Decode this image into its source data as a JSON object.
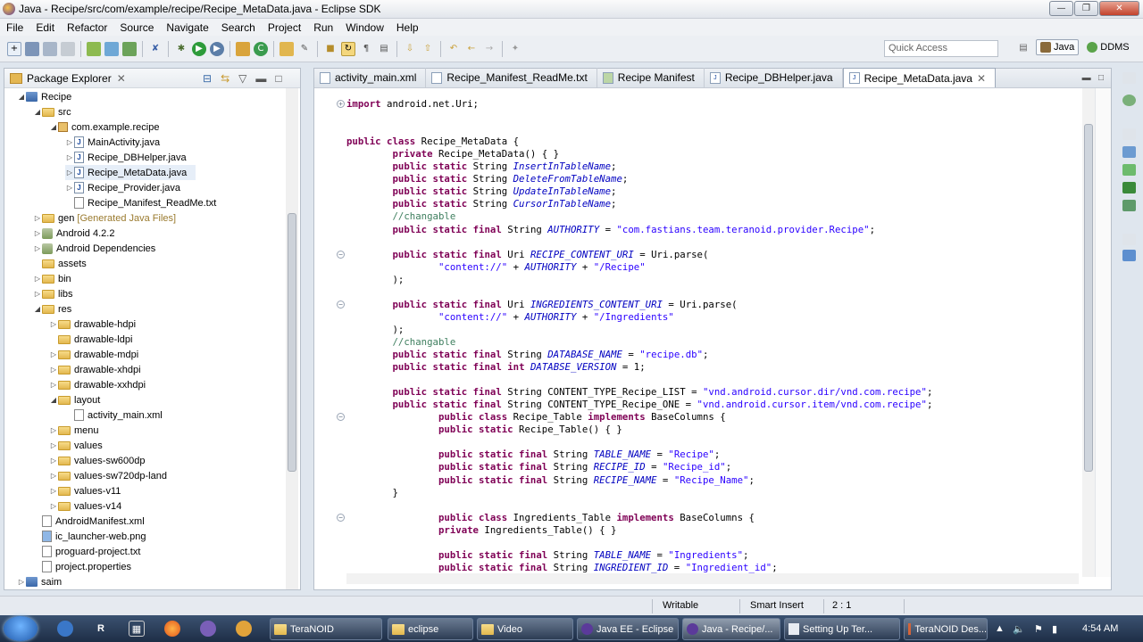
{
  "window": {
    "title": "Java - Recipe/src/com/example/recipe/Recipe_MetaData.java - Eclipse SDK"
  },
  "menu": [
    "File",
    "Edit",
    "Refactor",
    "Source",
    "Navigate",
    "Search",
    "Project",
    "Run",
    "Window",
    "Help"
  ],
  "toolbar": {
    "quick_access_placeholder": "Quick Access",
    "perspective_java": "Java",
    "perspective_ddms": "DDMS"
  },
  "package_explorer": {
    "title": "Package Explorer",
    "items": [
      {
        "label": "Recipe"
      },
      {
        "label": "src"
      },
      {
        "label": "com.example.recipe"
      },
      {
        "label": "MainActivity.java"
      },
      {
        "label": "Recipe_DBHelper.java"
      },
      {
        "label": "Recipe_MetaData.java"
      },
      {
        "label": "Recipe_Provider.java"
      },
      {
        "label": "Recipe_Manifest_ReadMe.txt"
      },
      {
        "label": "gen",
        "suffix": "[Generated Java Files]"
      },
      {
        "label": "Android 4.2.2"
      },
      {
        "label": "Android Dependencies"
      },
      {
        "label": "assets"
      },
      {
        "label": "bin"
      },
      {
        "label": "libs"
      },
      {
        "label": "res"
      },
      {
        "label": "drawable-hdpi"
      },
      {
        "label": "drawable-ldpi"
      },
      {
        "label": "drawable-mdpi"
      },
      {
        "label": "drawable-xhdpi"
      },
      {
        "label": "drawable-xxhdpi"
      },
      {
        "label": "layout"
      },
      {
        "label": "activity_main.xml"
      },
      {
        "label": "menu"
      },
      {
        "label": "values"
      },
      {
        "label": "values-sw600dp"
      },
      {
        "label": "values-sw720dp-land"
      },
      {
        "label": "values-v11"
      },
      {
        "label": "values-v14"
      },
      {
        "label": "AndroidManifest.xml"
      },
      {
        "label": "ic_launcher-web.png"
      },
      {
        "label": "proguard-project.txt"
      },
      {
        "label": "project.properties"
      },
      {
        "label": "saim"
      }
    ]
  },
  "editor": {
    "tabs": [
      "activity_main.xml",
      "Recipe_Manifest_ReadMe.txt",
      "Recipe Manifest",
      "Recipe_DBHelper.java",
      "Recipe_MetaData.java"
    ],
    "active_tab": "Recipe_MetaData.java",
    "code_lines": [
      "import android.net.Uri;",
      "",
      "",
      "public class Recipe_MetaData {",
      "        private Recipe_MetaData() { }",
      "        public static String InsertInTableName;",
      "        public static String DeleteFromTableName;",
      "        public static String UpdateInTableName;",
      "        public static String CursorInTableName;",
      "        //changable",
      "        public static final String AUTHORITY = \"com.fastians.team.teranoid.provider.Recipe\";",
      "",
      "        public static final Uri RECIPE_CONTENT_URI = Uri.parse(",
      "                \"content://\" + AUTHORITY + \"/Recipe\"",
      "        );",
      "",
      "        public static final Uri INGREDIENTS_CONTENT_URI = Uri.parse(",
      "                \"content://\" + AUTHORITY + \"/Ingredients\"",
      "        );",
      "        //changable",
      "        public static final String DATABASE_NAME = \"recipe.db\";",
      "        public static final int DATABSE_VERSION = 1;",
      "",
      "        public static final String CONTENT_TYPE_Recipe_LIST = \"vnd.android.cursor.dir/vnd.com.recipe\";",
      "        public static final String CONTENT_TYPE_Recipe_ONE = \"vnd.android.cursor.item/vnd.com.recipe\";",
      "                public class Recipe_Table implements BaseColumns {",
      "                public static Recipe_Table() { }",
      "",
      "                public static final String TABLE_NAME = \"Recipe\";",
      "                public static final String RECIPE_ID = \"Recipe_id\";",
      "                public static final String RECIPE_NAME = \"Recipe_Name\";",
      "        }",
      "",
      "                public class Ingredients_Table implements BaseColumns {",
      "                private Ingredients_Table() { }",
      "",
      "                public static final String TABLE_NAME = \"Ingredients\";",
      "                public static final String INGREDIENT_ID = \"Ingredient_id\";"
    ]
  },
  "status": {
    "writable": "Writable",
    "insert_mode": "Smart Insert",
    "position": "2 : 1"
  },
  "taskbar": {
    "tasks": [
      "TeraNOID",
      "eclipse",
      "Video",
      "Java EE - Eclipse",
      "Java - Recipe/...",
      "Setting Up Ter...",
      "TeraNOID Des..."
    ],
    "clock": "4:54 AM"
  }
}
